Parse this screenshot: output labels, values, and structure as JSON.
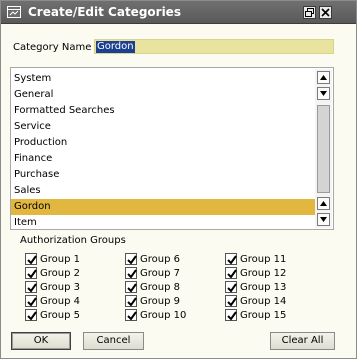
{
  "window": {
    "title": "Create/Edit Categories",
    "icons": {
      "title": "window-icon",
      "restore": "restore-icon",
      "close": "close-icon"
    }
  },
  "category": {
    "label": "Category Name",
    "value": "Gordon"
  },
  "list": {
    "items": [
      "System",
      "General",
      "Formatted Searches",
      "Service",
      "Production",
      "Finance",
      "Purchase",
      "Sales",
      "Gordon",
      "Item"
    ],
    "selected": "Gordon",
    "selected_color": "#e2b73f",
    "scroll_icons": [
      "scroll-up-icon",
      "scroll-down-icon"
    ]
  },
  "auth": {
    "title": "Authorization Groups",
    "groups": [
      {
        "label": "Group 1",
        "checked": true
      },
      {
        "label": "Group 2",
        "checked": true
      },
      {
        "label": "Group 3",
        "checked": true
      },
      {
        "label": "Group 4",
        "checked": true
      },
      {
        "label": "Group 5",
        "checked": true
      },
      {
        "label": "Group 6",
        "checked": true
      },
      {
        "label": "Group 7",
        "checked": true
      },
      {
        "label": "Group 8",
        "checked": true
      },
      {
        "label": "Group 9",
        "checked": true
      },
      {
        "label": "Group 10",
        "checked": true
      },
      {
        "label": "Group 11",
        "checked": true
      },
      {
        "label": "Group 12",
        "checked": true
      },
      {
        "label": "Group 13",
        "checked": true
      },
      {
        "label": "Group 14",
        "checked": true
      },
      {
        "label": "Group 15",
        "checked": true
      }
    ]
  },
  "buttons": {
    "ok": "OK",
    "cancel": "Cancel",
    "clear_all": "Clear All"
  },
  "colors": {
    "titlebar": "#5e5e5e",
    "input_bg": "#e8e4a0",
    "input_selection": "#1c3f92",
    "window_bg": "#fbfbf1"
  }
}
